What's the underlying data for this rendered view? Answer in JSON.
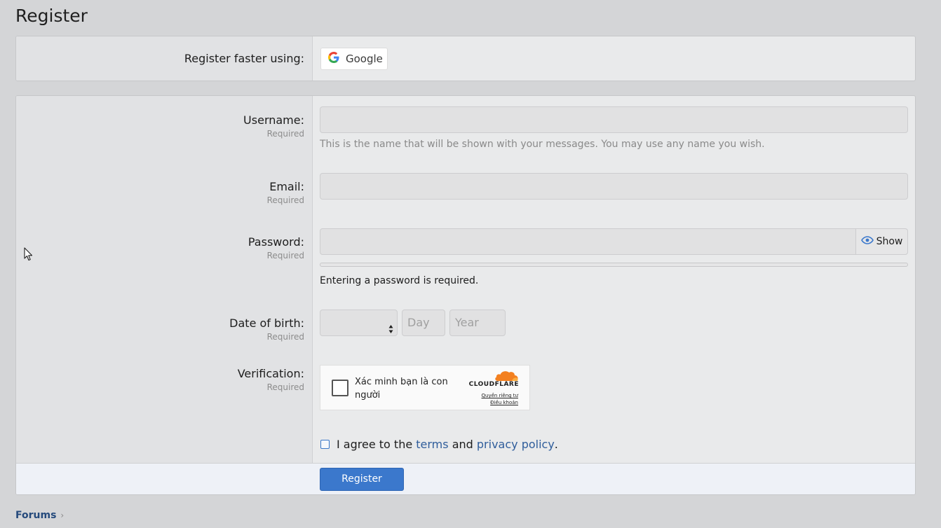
{
  "page": {
    "title": "Register"
  },
  "fast_register": {
    "label": "Register faster using:",
    "google_label": "Google",
    "google_icon": "google-g-icon"
  },
  "form": {
    "username": {
      "label": "Username:",
      "required": "Required",
      "value": "",
      "hint": "This is the name that will be shown with your messages. You may use any name you wish."
    },
    "email": {
      "label": "Email:",
      "required": "Required",
      "value": ""
    },
    "password": {
      "label": "Password:",
      "required": "Required",
      "value": "",
      "show_label": "Show",
      "show_icon": "eye-icon",
      "message": "Entering a password is required.",
      "strength": 0
    },
    "dob": {
      "label": "Date of birth:",
      "required": "Required",
      "month_value": "",
      "day_placeholder": "Day",
      "year_placeholder": "Year"
    },
    "verification": {
      "label": "Verification:",
      "required": "Required",
      "widget_text": "Xác minh bạn là con người",
      "brand": "CLOUDFLARE",
      "privacy_link": "Quyền riêng tư",
      "terms_link": "Điều khoản"
    },
    "agree": {
      "prefix": "I agree to the ",
      "terms": "terms",
      "middle": " and ",
      "privacy": "privacy policy",
      "suffix": ".",
      "checked": false
    },
    "submit_label": "Register"
  },
  "breadcrumb": {
    "items": [
      "Forums"
    ]
  },
  "colors": {
    "accent": "#3b78cc",
    "link": "#2f5d9b",
    "cloudflare_orange": "#f38020"
  }
}
